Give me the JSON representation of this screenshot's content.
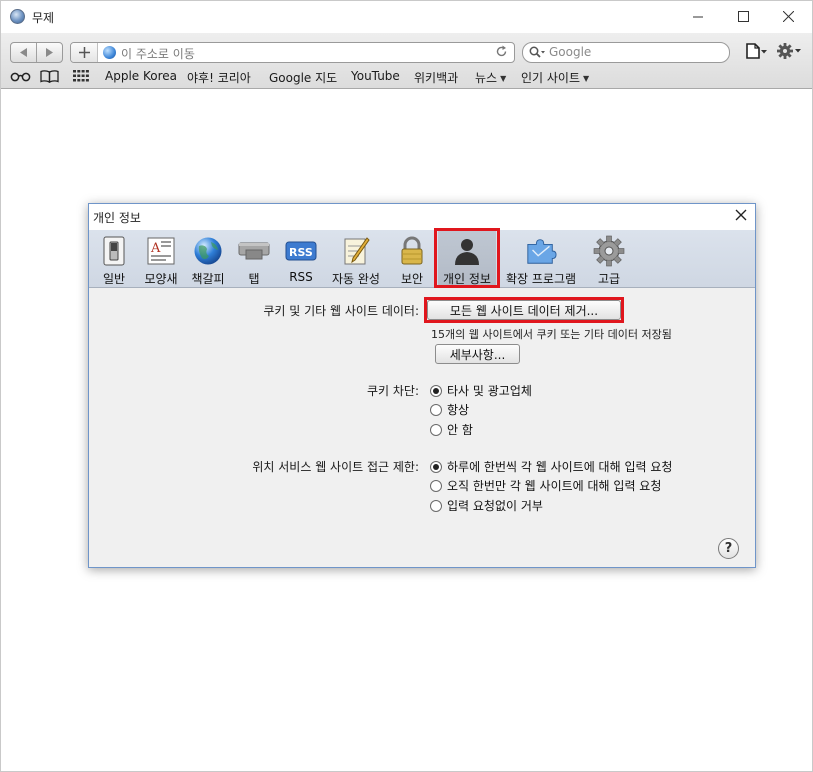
{
  "window": {
    "title": "무제"
  },
  "toolbar": {
    "address_placeholder": "이 주소로 이동",
    "search_placeholder": "Google"
  },
  "bookmarks": {
    "items": [
      {
        "label": "Apple Korea"
      },
      {
        "label": "야후! 코리아"
      },
      {
        "label": "Google 지도"
      },
      {
        "label": "YouTube"
      },
      {
        "label": "위키백과"
      },
      {
        "label": "뉴스",
        "has_menu": true
      },
      {
        "label": "인기 사이트",
        "has_menu": true
      }
    ]
  },
  "dialog": {
    "title": "개인 정보",
    "tabs": [
      {
        "label": "일반",
        "icon": "switch-icon"
      },
      {
        "label": "모양새",
        "icon": "appearance-icon"
      },
      {
        "label": "책갈피",
        "icon": "globe-icon"
      },
      {
        "label": "탭",
        "icon": "tabs-icon"
      },
      {
        "label": "RSS",
        "icon": "rss-icon"
      },
      {
        "label": "자동 완성",
        "icon": "autofill-icon"
      },
      {
        "label": "보안",
        "icon": "lock-icon"
      },
      {
        "label": "개인 정보",
        "icon": "person-icon",
        "selected": true
      },
      {
        "label": "확장 프로그램",
        "icon": "extensions-icon"
      },
      {
        "label": "고급",
        "icon": "gear-icon"
      }
    ],
    "cookies": {
      "label": "쿠키 및 기타 웹 사이트 데이터:",
      "remove_all_button": "모든 웹 사이트 데이터 제거...",
      "stored_note": "15개의 웹 사이트에서 쿠키 또는 기타 데이터 저장됨",
      "details_button": "세부사항..."
    },
    "block_cookies": {
      "label": "쿠키 차단:",
      "options": [
        "타사 및 광고업체",
        "항상",
        "안 함"
      ],
      "selected_index": 0
    },
    "location": {
      "label": "위치 서비스 웹 사이트 접근 제한:",
      "options": [
        "하루에 한번씩 각 웹 사이트에 대해 입력 요청",
        "오직 한번만 각 웹 사이트에 대해 입력 요청",
        "입력 요청없이 거부"
      ],
      "selected_index": 0
    },
    "help_label": "?"
  },
  "accent": {
    "highlight_red": "#e0161d",
    "dialog_border": "#6f95c9"
  }
}
